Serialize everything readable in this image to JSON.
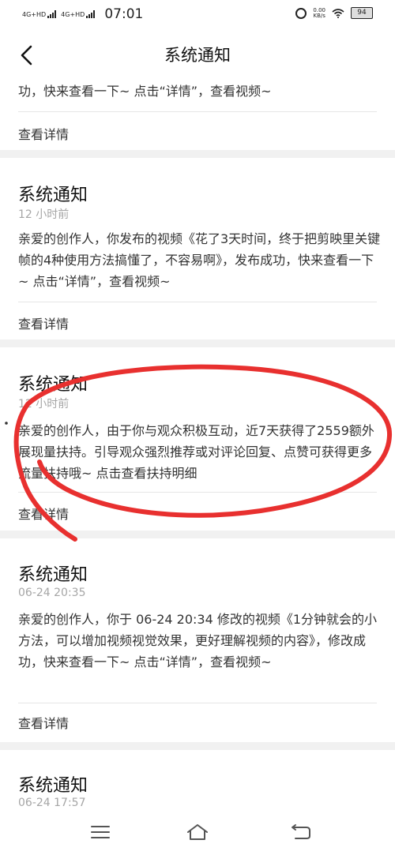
{
  "status_bar": {
    "signal_1": "4G+HD",
    "signal_2": "4G+HD",
    "time": "07:01",
    "net_speed_value": "0.00",
    "net_speed_unit": "KB/s",
    "battery": "94",
    "icons": [
      "alarm-icon",
      "wifi-icon",
      "battery-icon"
    ]
  },
  "header": {
    "back_icon": "chevron-left-icon",
    "title": "系统通知"
  },
  "notifications": [
    {
      "title": "",
      "time": "",
      "body": "功，快来查看一下~ 点击“详情”，查看视频~",
      "link": "查看详情"
    },
    {
      "title": "系统通知",
      "time": "12 小时前",
      "body": "亲爱的创作人，你发布的视频《花了3天时间，终于把剪映里关键帧的4种使用方法搞懂了，不容易啊》，发布成功，快来查看一下~ 点击“详情”，查看视频~",
      "link": "查看详情"
    },
    {
      "title": "系统通知",
      "time": "12 小时前",
      "body": "亲爱的创作人，由于你与观众积极互动，近7天获得了2559额外展现量扶持。引导观众强烈推荐或对评论回复、点赞可获得更多流量扶持哦~ 点击查看扶持明细",
      "link": "查看详情"
    },
    {
      "title": "系统通知",
      "time": "06-24 20:35",
      "body": "亲爱的创作人，你于 06-24 20:34 修改的视频《1分钟就会的小方法，可以增加视频视觉效果，更好理解视频的内容》，修改成功，快来查看一下~ 点击“详情”，查看视频~",
      "link": "查看详情"
    },
    {
      "title": "系统通知",
      "time": "06-24 17:57",
      "body": "",
      "link": ""
    }
  ],
  "annotation": {
    "color": "#e8302f",
    "shape": "hand-drawn-ellipse"
  },
  "bottom_nav": {
    "icons": [
      "menu-icon",
      "home-icon",
      "back-icon"
    ]
  }
}
